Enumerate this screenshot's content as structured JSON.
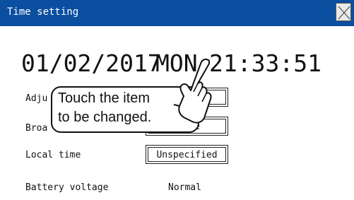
{
  "window": {
    "title": "Time setting",
    "colors": {
      "titlebar": "#0a4fa0",
      "title_text": "#ffffff"
    }
  },
  "clock": {
    "date": "01/02/2017",
    "weekday": "MON",
    "time": "21:33:51"
  },
  "rows": {
    "adjust": {
      "label": "Adju",
      "value": ""
    },
    "broadcast": {
      "label": "Broa",
      "value": "se"
    },
    "local_time": {
      "label": "Local time",
      "value": "Unspecified"
    },
    "battery": {
      "label": "Battery voltage",
      "value": "Normal"
    }
  },
  "callout": {
    "text": "Touch the item\nto be changed.",
    "icon": "pointing-hand-icon"
  },
  "icons": {
    "close": "close-icon"
  }
}
